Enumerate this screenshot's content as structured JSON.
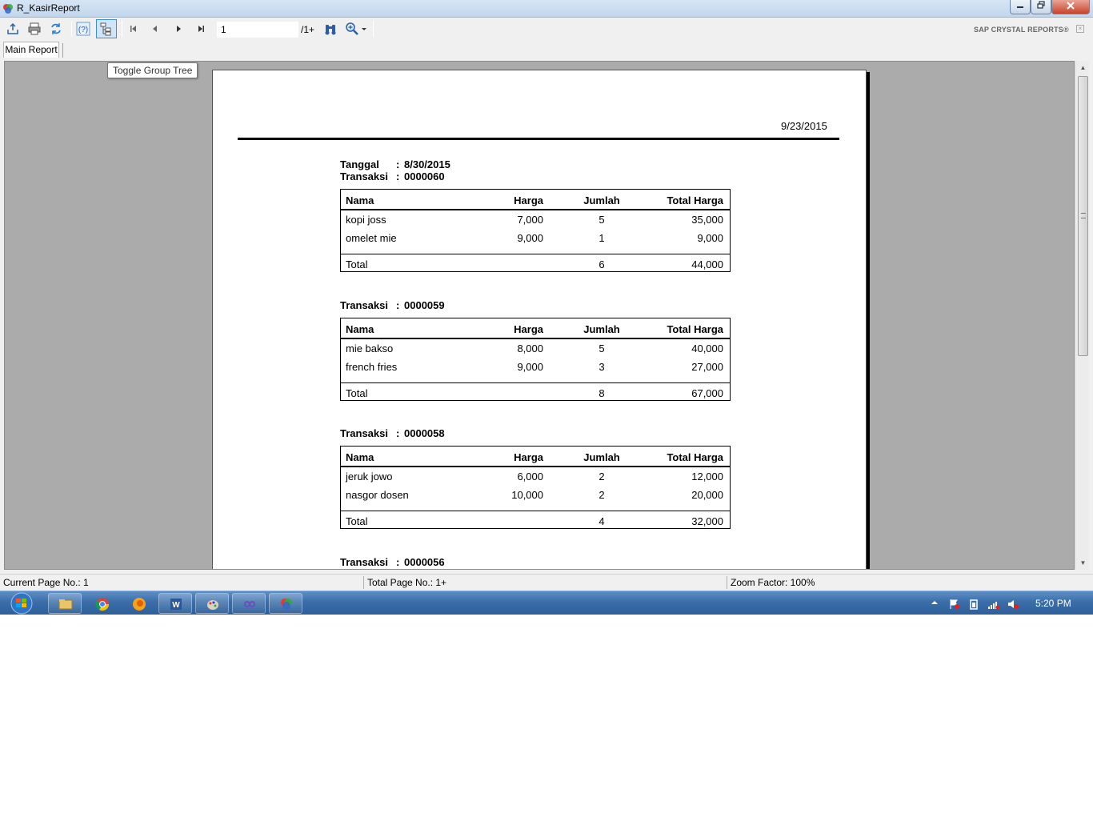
{
  "window": {
    "title": "R_KasirReport"
  },
  "toolbar": {
    "page_value": "1",
    "page_total": "/1+",
    "brand": "SAP CRYSTAL REPORTS®"
  },
  "tabs": {
    "main": "Main Report"
  },
  "tooltip": "Toggle Group Tree",
  "report": {
    "print_date": "9/23/2015",
    "tanggal_label": "Tanggal",
    "tanggal_value": "8/30/2015",
    "transaksi_label": "Transaksi",
    "colon": ":",
    "headers": {
      "nama": "Nama",
      "harga": "Harga",
      "jumlah": "Jumlah",
      "total_harga": "Total Harga"
    },
    "total_label": "Total",
    "transactions": [
      {
        "id": "0000060",
        "items": [
          {
            "nama": "kopi joss",
            "harga": "7,000",
            "jumlah": "5",
            "total": "35,000"
          },
          {
            "nama": "omelet mie",
            "harga": "9,000",
            "jumlah": "1",
            "total": "9,000"
          }
        ],
        "total_jumlah": "6",
        "total_harga": "44,000"
      },
      {
        "id": "0000059",
        "items": [
          {
            "nama": "mie bakso",
            "harga": "8,000",
            "jumlah": "5",
            "total": "40,000"
          },
          {
            "nama": "french fries",
            "harga": "9,000",
            "jumlah": "3",
            "total": "27,000"
          }
        ],
        "total_jumlah": "8",
        "total_harga": "67,000"
      },
      {
        "id": "0000058",
        "items": [
          {
            "nama": "jeruk jowo",
            "harga": "6,000",
            "jumlah": "2",
            "total": "12,000"
          },
          {
            "nama": "nasgor dosen",
            "harga": "10,000",
            "jumlah": "2",
            "total": "20,000"
          }
        ],
        "total_jumlah": "4",
        "total_harga": "32,000"
      },
      {
        "id": "0000056",
        "items": []
      }
    ]
  },
  "status": {
    "current_page": "Current Page No.: 1",
    "total_page": "Total Page No.: 1+",
    "zoom": "Zoom Factor: 100%"
  },
  "taskbar": {
    "clock": "5:20 PM"
  },
  "colors": {
    "accent": "#3f8fd6",
    "viewer_bg": "#ababab",
    "taskbar": "#3b6ea8"
  }
}
